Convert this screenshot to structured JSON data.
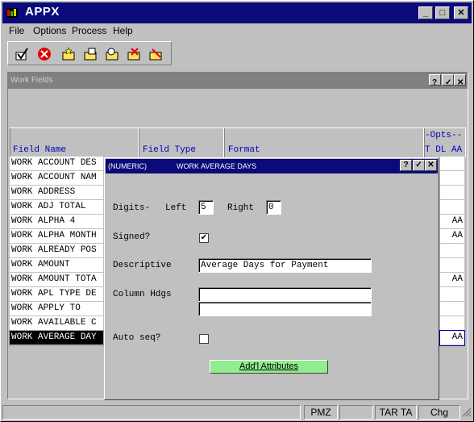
{
  "app": {
    "title": "APPX"
  },
  "menu": {
    "file": "File",
    "options": "Options",
    "process": "Process",
    "help": "Help"
  },
  "toolbar": {
    "icons": [
      "check-icon",
      "stop-icon",
      "new-folder-icon",
      "open-folder-icon",
      "search-folder-icon",
      "delete-folder-icon",
      "cancel-folder-icon"
    ]
  },
  "window": {
    "title": "Work Fields",
    "help": "?"
  },
  "grid": {
    "headers": {
      "field_name": "Field Name",
      "field_type": "Field Type",
      "format": "Format",
      "opts": "-Opts--",
      "t_dl_aa": "T DL AA"
    },
    "rows": [
      {
        "name": "WORK ACCOUNT DES",
        "aa": ""
      },
      {
        "name": "WORK ACCOUNT NAM",
        "aa": ""
      },
      {
        "name": "WORK ADDRESS",
        "aa": ""
      },
      {
        "name": "WORK ADJ TOTAL",
        "aa": ""
      },
      {
        "name": "WORK ALPHA 4",
        "aa": "AA"
      },
      {
        "name": "WORK ALPHA MONTH",
        "aa": "AA"
      },
      {
        "name": "WORK ALREADY POS",
        "aa": ""
      },
      {
        "name": "WORK AMOUNT",
        "aa": ""
      },
      {
        "name": "WORK AMOUNT TOTA",
        "aa": "AA"
      },
      {
        "name": "WORK APL TYPE DE",
        "aa": ""
      },
      {
        "name": "WORK APPLY TO",
        "aa": ""
      },
      {
        "name": "WORK AVAILABLE C",
        "aa": ""
      },
      {
        "name": "WORK AVERAGE DAY",
        "aa": "AA"
      }
    ]
  },
  "dialog": {
    "type": "(NUMERIC)",
    "title": "WORK AVERAGE DAYS",
    "help": "?",
    "digits_label": "Digits-",
    "left_label": "Left",
    "left_value": "5",
    "right_label": "Right",
    "right_value": "0",
    "signed_label": "Signed?",
    "signed_mark": "✔",
    "descriptive_label": "Descriptive",
    "descriptive_value": "Average Days for Payment",
    "column_hdgs_label": "Column Hdgs",
    "column_hdg_1": "",
    "column_hdg_2": "",
    "auto_seq_label": "Auto seq?",
    "auto_seq_mark": "",
    "add_attributes": "Add'l Attributes"
  },
  "status": {
    "pmz": "PMZ",
    "tar": "TAR TA",
    "chg": "Chg"
  },
  "colors": {
    "title_blue": "#0a0a7a",
    "header_text": "#0000c0",
    "add_button": "#90ee90"
  }
}
